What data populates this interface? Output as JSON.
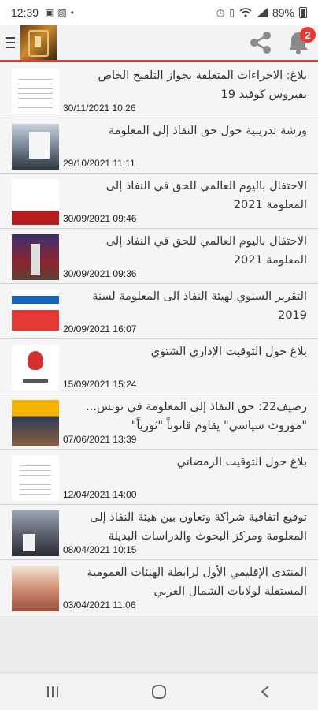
{
  "status_bar": {
    "time": "12:39",
    "battery": "89%",
    "icons": [
      "gallery-icon",
      "photo-icon",
      "dot-icon",
      "alarm-icon",
      "vibrate-icon",
      "wifi-icon",
      "signal-icon",
      "battery-icon"
    ]
  },
  "app_bar": {
    "menu_icon": "menu-icon",
    "logo": "app-logo",
    "share_icon": "share-icon",
    "bell_icon": "bell-icon",
    "notification_count": "2",
    "accent_color": "#e53935"
  },
  "news": [
    {
      "title": "بلاغ: الاجراءات المتعلقة بجواز التلقيح الخاص بفيروس كوفيد 19",
      "date": "30/11/2021 10:26"
    },
    {
      "title": "ورشة تدريبية حول حق النفاذ إلى المعلومة",
      "date": "29/10/2021 11:11"
    },
    {
      "title": "الاحتفال باليوم العالمي للحق في النفاذ إلى المعلومة 2021",
      "date": "30/09/2021 09:46"
    },
    {
      "title": "الاحتفال باليوم العالمي للحق في النفاذ إلى المعلومة 2021",
      "date": "30/09/2021 09:36"
    },
    {
      "title": "التقرير السنوي لهيئة النفاذ الى المعلومة لسنة 2019",
      "date": "20/09/2021 16:07"
    },
    {
      "title": "بلاغ حول التوقيت الإداري الشتوي",
      "date": "15/09/2021 15:24"
    },
    {
      "title": "رصيف22: حق النفاذ إلى المعلومة في تونس... \"موروث سياسي\" يقاوم قانوناً \"ثورياً\"",
      "date": "07/06/2021 13:39"
    },
    {
      "title": "بلاغ حول التوقيت الرمضاني",
      "date": "12/04/2021 14:00"
    },
    {
      "title": "توقيع اتفاقية شراكة وتعاون بين هيئة النفاذ إلى المعلومة ومركز البحوث والدراسات البديلة",
      "date": "08/04/2021 10:15"
    },
    {
      "title": "المنتدى الإقليمي الأول لرابطة الهيئات العمومية المستقلة لولايات الشمال الغربي",
      "date": "03/04/2021 11:06"
    }
  ],
  "nav_bar": {
    "icons": [
      "recent-apps-icon",
      "home-icon",
      "back-icon"
    ]
  }
}
